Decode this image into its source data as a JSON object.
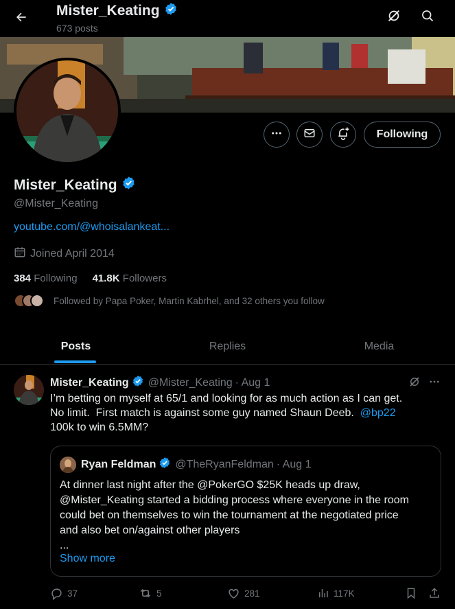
{
  "header": {
    "display_name": "Mister_Keating",
    "posts_count": "673 posts"
  },
  "profile": {
    "display_name": "Mister_Keating",
    "handle": "@Mister_Keating",
    "website": "youtube.com/@whoisalankeat...",
    "joined": "Joined April 2014",
    "following_count": "384",
    "following_label": "Following",
    "followers_count": "41.8K",
    "followers_label": "Followers",
    "followed_by": "Followed by Papa Poker, Martin Kabrhel, and 32 others you follow",
    "follow_button": "Following"
  },
  "tabs": [
    {
      "label": "Posts"
    },
    {
      "label": "Replies"
    },
    {
      "label": "Media"
    }
  ],
  "tweet": {
    "name": "Mister_Keating",
    "handle": "@Mister_Keating",
    "time": "· Aug 1",
    "line1": "I’m betting on myself at 65/1 and looking for as much action as I can get.",
    "line2_pre": "No limit.  First match is against some guy named Shaun Deeb.  ",
    "mention": "@bp22",
    "line3": "100k to win 6.5MM?",
    "quote": {
      "name": "Ryan Feldman",
      "handle": "@TheRyanFeldman",
      "time": "· Aug 1",
      "text_lines": [
        "At dinner last night after the @PokerGO $25K heads up draw,",
        "@Mister_Keating started a bidding process where everyone in the room",
        "could bet on themselves to win the tournament at the negotiated price",
        "and also bet on/against other players",
        "..."
      ],
      "show_more": "Show more"
    },
    "replies": "37",
    "reposts": "5",
    "likes": "281",
    "views": "117K"
  },
  "colors": {
    "accent": "#1d9bf0",
    "muted": "#71767b",
    "border": "#2f3336",
    "background": "#000000"
  }
}
